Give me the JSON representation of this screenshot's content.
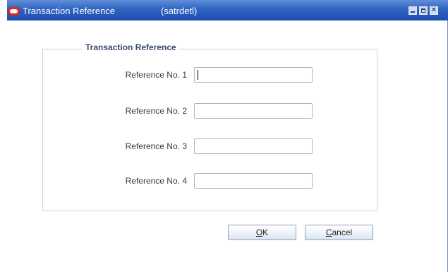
{
  "window": {
    "title": "Transaction Reference",
    "module": "(satrdetl)",
    "controls": {
      "minimize_icon": "minimize-icon",
      "maximize_icon": "maximize-icon",
      "close_icon": "close-icon"
    },
    "accent_color": "#2f63c2",
    "app_icon_color": "#e8231b"
  },
  "group": {
    "title": "Transaction Reference",
    "fields": [
      {
        "label": "Reference No. 1",
        "value": ""
      },
      {
        "label": "Reference No. 2",
        "value": ""
      },
      {
        "label": "Reference No. 3",
        "value": ""
      },
      {
        "label": "Reference No. 4",
        "value": ""
      }
    ]
  },
  "buttons": {
    "ok": {
      "mnemonic": "O",
      "rest": "K"
    },
    "cancel": {
      "mnemonic": "C",
      "rest": "ancel"
    }
  }
}
